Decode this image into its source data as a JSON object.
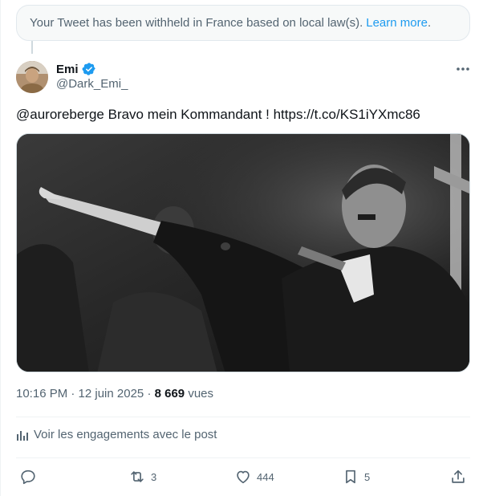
{
  "withheld": {
    "message": "Your Tweet has been withheld in France based on local law(s).",
    "link": "Learn more",
    "suffix": "."
  },
  "author": {
    "name": "Emi",
    "handle": "@Dark_Emi_",
    "verified": true
  },
  "tweet": {
    "text": "@auroreberge Bravo mein Kommandant ! https://t.co/KS1iYXmc86"
  },
  "meta": {
    "time": "10:16 PM · 12 juin 2025 · ",
    "views_count": "8 669",
    "views_label": " vues"
  },
  "engagements": {
    "label": "Voir les engagements avec le post"
  },
  "actions": {
    "retweets": "3",
    "likes": "444",
    "bookmarks": "5"
  },
  "colors": {
    "accent": "#1d9bf0",
    "text": "#0f1419",
    "secondary": "#536471"
  }
}
